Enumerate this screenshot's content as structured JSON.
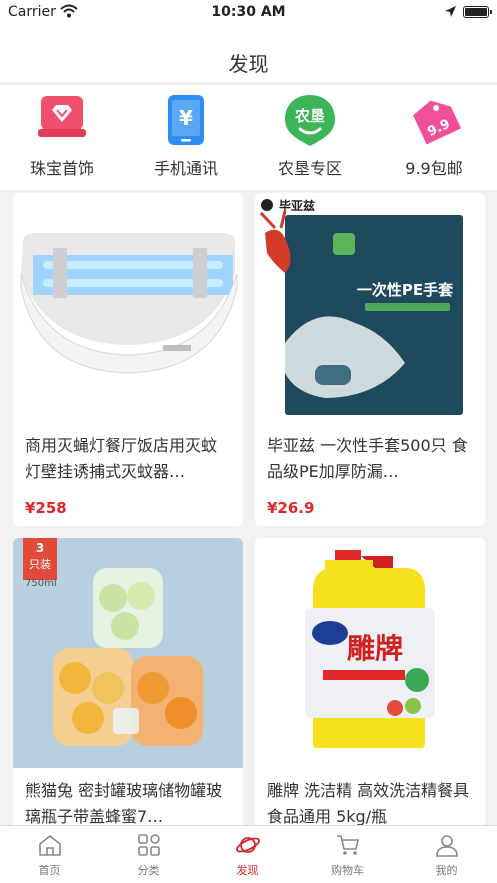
{
  "status_bar": {
    "carrier": "Carrier",
    "time": "10:30 AM"
  },
  "nav": {
    "title": "发现"
  },
  "categories": [
    {
      "label": "珠宝首饰",
      "icon": "jewelry-icon",
      "color": "#f0506e"
    },
    {
      "label": "手机通讯",
      "icon": "phone-yen-icon",
      "color": "#2f8cf0"
    },
    {
      "label": "农垦专区",
      "icon": "nongken-icon",
      "icon_text": "农垦",
      "color": "#3cb558"
    },
    {
      "label": "9.9包邮",
      "icon": "price-tag-icon",
      "icon_text": "9.9",
      "color": "#f0509a"
    }
  ],
  "products": [
    {
      "name": "商用灭蝇灯餐厅饭店用灭蚊灯壁挂诱捕式灭蚊器…",
      "price": "¥258",
      "image": "fly-killer-lamp-image"
    },
    {
      "name": "毕亚兹 一次性手套500只 食品级PE加厚防漏…",
      "price": "¥26.9",
      "image": "disposable-gloves-image",
      "brand_text": "毕亚兹",
      "package_text": "一次性PE手套"
    },
    {
      "name": "熊猫兔 密封罐玻璃储物罐玻璃瓶子带盖蜂蜜7…",
      "price": "",
      "image": "glass-jars-image",
      "badge_number": "3",
      "badge_text": "只装",
      "volume_text": "750ml"
    },
    {
      "name": "雕牌 洗洁精 高效洗洁精餐具 食品通用 5kg/瓶",
      "price": "",
      "image": "detergent-bottle-image",
      "label_text": "雕牌"
    }
  ],
  "tabs": [
    {
      "label": "首页",
      "icon": "home-icon",
      "active": false
    },
    {
      "label": "分类",
      "icon": "grid-icon",
      "active": false
    },
    {
      "label": "发现",
      "icon": "planet-icon",
      "active": true
    },
    {
      "label": "购物车",
      "icon": "cart-icon",
      "active": false
    },
    {
      "label": "我的",
      "icon": "user-icon",
      "active": false
    }
  ],
  "colors": {
    "accent": "#d8262e",
    "price": "#e02828",
    "background": "#f2f2f2"
  }
}
